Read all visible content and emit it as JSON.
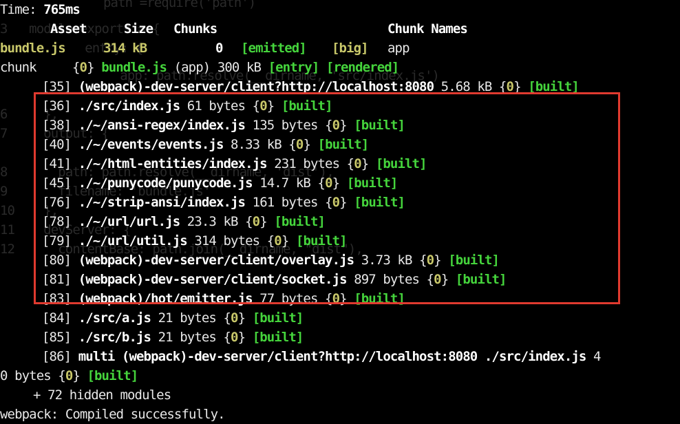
{
  "time_line": {
    "label": "Time: ",
    "value": "765ms"
  },
  "header": {
    "asset": "Asset",
    "size": "Size",
    "chunks": "Chunks",
    "chunk_names": "Chunk Names"
  },
  "asset_row": {
    "name": "bundle.js",
    "size": "314 kB",
    "chunks": "0",
    "emitted": "[emitted]",
    "big": "[big]",
    "chunk_name": "app"
  },
  "chunk_line": {
    "label": "chunk",
    "open": "{",
    "id": "0",
    "close": "}",
    "file": "bundle.js",
    "rest": " (app) 300 kB ",
    "entry": "[entry]",
    "rendered": "[rendered]"
  },
  "modules": [
    {
      "id": "[35]",
      "path": "(webpack)-dev-server/client?http://localhost:8080",
      "size": "5.68 kB",
      "chunk": "0",
      "status": "[built]"
    },
    {
      "id": "[36]",
      "path": "./src/index.js",
      "size": "61 bytes",
      "chunk": "0",
      "status": "[built]"
    },
    {
      "id": "[38]",
      "path": "./~/ansi-regex/index.js",
      "size": "135 bytes",
      "chunk": "0",
      "status": "[built]"
    },
    {
      "id": "[40]",
      "path": "./~/events/events.js",
      "size": "8.33 kB",
      "chunk": "0",
      "status": "[built]"
    },
    {
      "id": "[41]",
      "path": "./~/html-entities/index.js",
      "size": "231 bytes",
      "chunk": "0",
      "status": "[built]"
    },
    {
      "id": "[45]",
      "path": "./~/punycode/punycode.js",
      "size": "14.7 kB",
      "chunk": "0",
      "status": "[built]"
    },
    {
      "id": "[76]",
      "path": "./~/strip-ansi/index.js",
      "size": "161 bytes",
      "chunk": "0",
      "status": "[built]"
    },
    {
      "id": "[78]",
      "path": "./~/url/url.js",
      "size": "23.3 kB",
      "chunk": "0",
      "status": "[built]"
    },
    {
      "id": "[79]",
      "path": "./~/url/util.js",
      "size": "314 bytes",
      "chunk": "0",
      "status": "[built]"
    },
    {
      "id": "[80]",
      "path": "(webpack)-dev-server/client/overlay.js",
      "size": "3.73 kB",
      "chunk": "0",
      "status": "[built]"
    },
    {
      "id": "[81]",
      "path": "(webpack)-dev-server/client/socket.js",
      "size": "897 bytes",
      "chunk": "0",
      "status": "[built]"
    },
    {
      "id": "[83]",
      "path": "(webpack)/hot/emitter.js",
      "size": "77 bytes",
      "chunk": "0",
      "status": "[built]"
    },
    {
      "id": "[84]",
      "path": "./src/a.js",
      "size": "21 bytes",
      "chunk": "0",
      "status": "[built]"
    },
    {
      "id": "[85]",
      "path": "./src/b.js",
      "size": "21 bytes",
      "chunk": "0",
      "status": "[built]"
    },
    {
      "id": "[86]",
      "path": "multi (webpack)-dev-server/client?http://localhost:8080 ./src/index.js",
      "size": "4",
      "chunk": "",
      "status": ""
    }
  ],
  "wrap_line": {
    "text": "0 bytes ",
    "chunk": "0",
    "status": "[built]"
  },
  "hidden_modules": "+ 72 hidden modules",
  "final_status": "webpack: Compiled successfully.",
  "ghost_lines": [
    "path =require('path')",
    "3   module.exports = {",
    "      entry: {",
    "        app: path.resolve(__dirname, 'src/index.js')",
    "6     },",
    "7     output: {",
    "8       path: path.resolve(__dirname, 'dist'),",
    "9       filename: 'bundle.js'",
    "10    },",
    "11    devServer: {",
    "12      contentBase: path.join(__dirname, \"dist\"),"
  ],
  "colors": {
    "bold_white": "#ffffff",
    "yellow": "#c9c86a",
    "green": "#45d43c",
    "red_box": "#e03a2f",
    "background": "#000000"
  }
}
